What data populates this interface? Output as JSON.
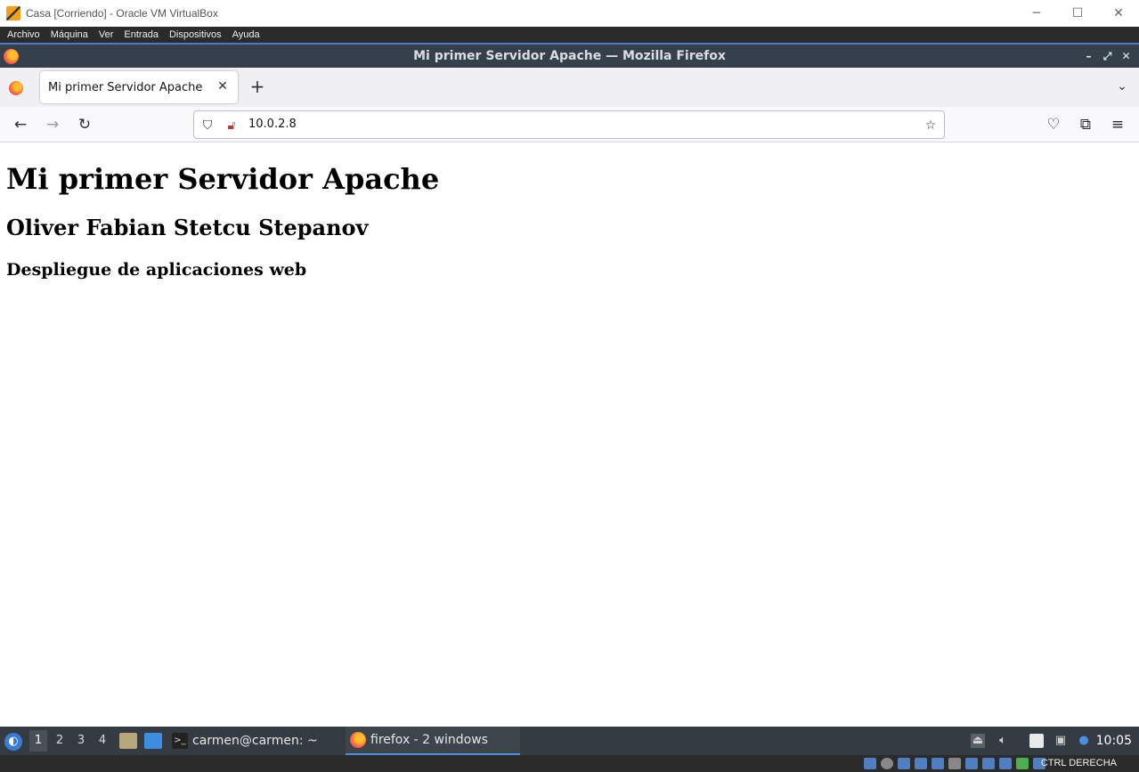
{
  "vbox": {
    "title": "Casa [Corriendo] - Oracle VM VirtualBox",
    "menu": [
      "Archivo",
      "Máquina",
      "Ver",
      "Entrada",
      "Dispositivos",
      "Ayuda"
    ],
    "host_key": "CTRL DERECHA"
  },
  "firefox": {
    "window_title": "Mi primer Servidor Apache — Mozilla Firefox",
    "tab_title": "Mi primer Servidor Apache",
    "url": "10.0.2.8"
  },
  "page": {
    "h1": "Mi primer Servidor Apache",
    "h2": "Oliver Fabian Stetcu Stepanov",
    "h3": "Despliegue de aplicaciones web"
  },
  "taskbar": {
    "desktops": [
      "1",
      "2",
      "3",
      "4"
    ],
    "terminal_task": "carmen@carmen: ~",
    "firefox_task": "firefox - 2 windows",
    "clock": "10:05"
  }
}
